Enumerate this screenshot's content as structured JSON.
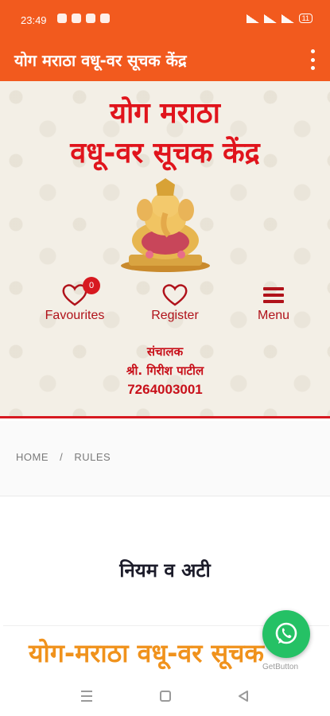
{
  "status_bar": {
    "time": "23:49",
    "battery": "11"
  },
  "app_bar": {
    "title": "योग मराठा वधू-वर सूचक केंद्र"
  },
  "header": {
    "brand_line1": "योग मराठा",
    "brand_line2": "वधू-वर सूचक केंद्र",
    "actions": {
      "favourites_label": "Favourites",
      "favourites_count": "0",
      "register_label": "Register",
      "menu_label": "Menu"
    },
    "contact": {
      "role": "संचालक",
      "name": "श्री. गिरीश पाटील",
      "phone": "7264003001"
    }
  },
  "breadcrumb": {
    "home": "HOME",
    "separator": "/",
    "current": "RULES"
  },
  "page": {
    "heading": "नियम व अटी",
    "banner_text": "योग-मराठा वधू-वर सूचक"
  },
  "widget": {
    "getbutton": "GetButton"
  },
  "colors": {
    "primary": "#f25a1e",
    "brand_red": "#e0141c",
    "banner_orange": "#f0921c",
    "whatsapp": "#25c165"
  }
}
